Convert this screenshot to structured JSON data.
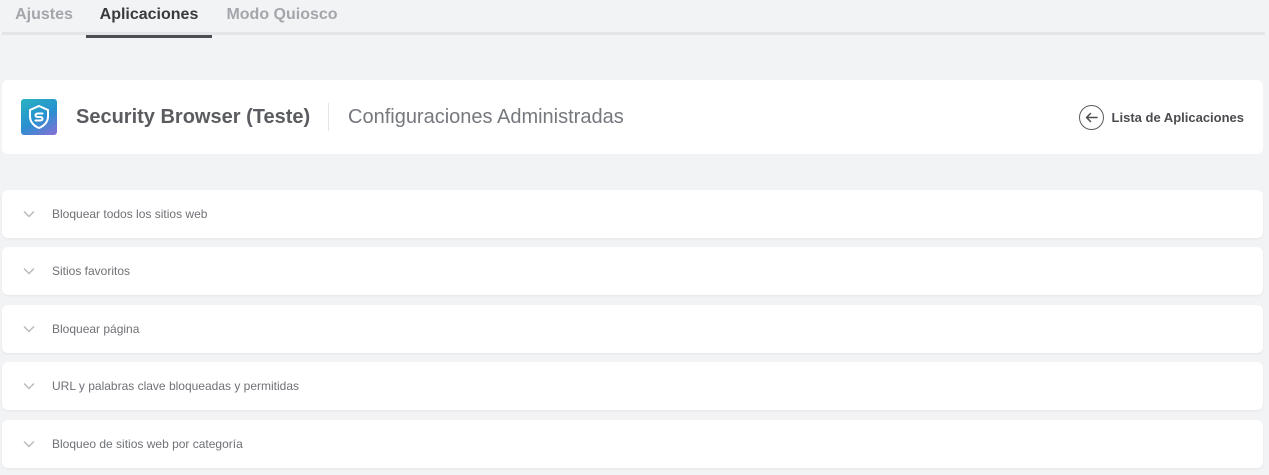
{
  "tabs": [
    {
      "label": "Ajustes"
    },
    {
      "label": "Aplicaciones"
    },
    {
      "label": "Modo Quiosco"
    }
  ],
  "header": {
    "app_name": "Security Browser (Teste)",
    "section": "Configuraciones Administradas",
    "back_label": "Lista de Aplicaciones",
    "icon": "shield-s-icon",
    "back_icon": "arrow-left-circle-icon"
  },
  "sections": [
    {
      "label": "Bloquear todos los sitios web"
    },
    {
      "label": "Sitios favoritos"
    },
    {
      "label": "Bloquear página"
    },
    {
      "label": "URL y palabras clave bloqueadas y permitidas"
    },
    {
      "label": "Bloqueo de sitios web por categoría"
    }
  ],
  "colors": {
    "background": "#f2f3f5",
    "card": "#ffffff",
    "active_tab_underline": "#4a4d52",
    "icon_gradient_start": "#27b3c2",
    "icon_gradient_end": "#8b6fd6"
  }
}
